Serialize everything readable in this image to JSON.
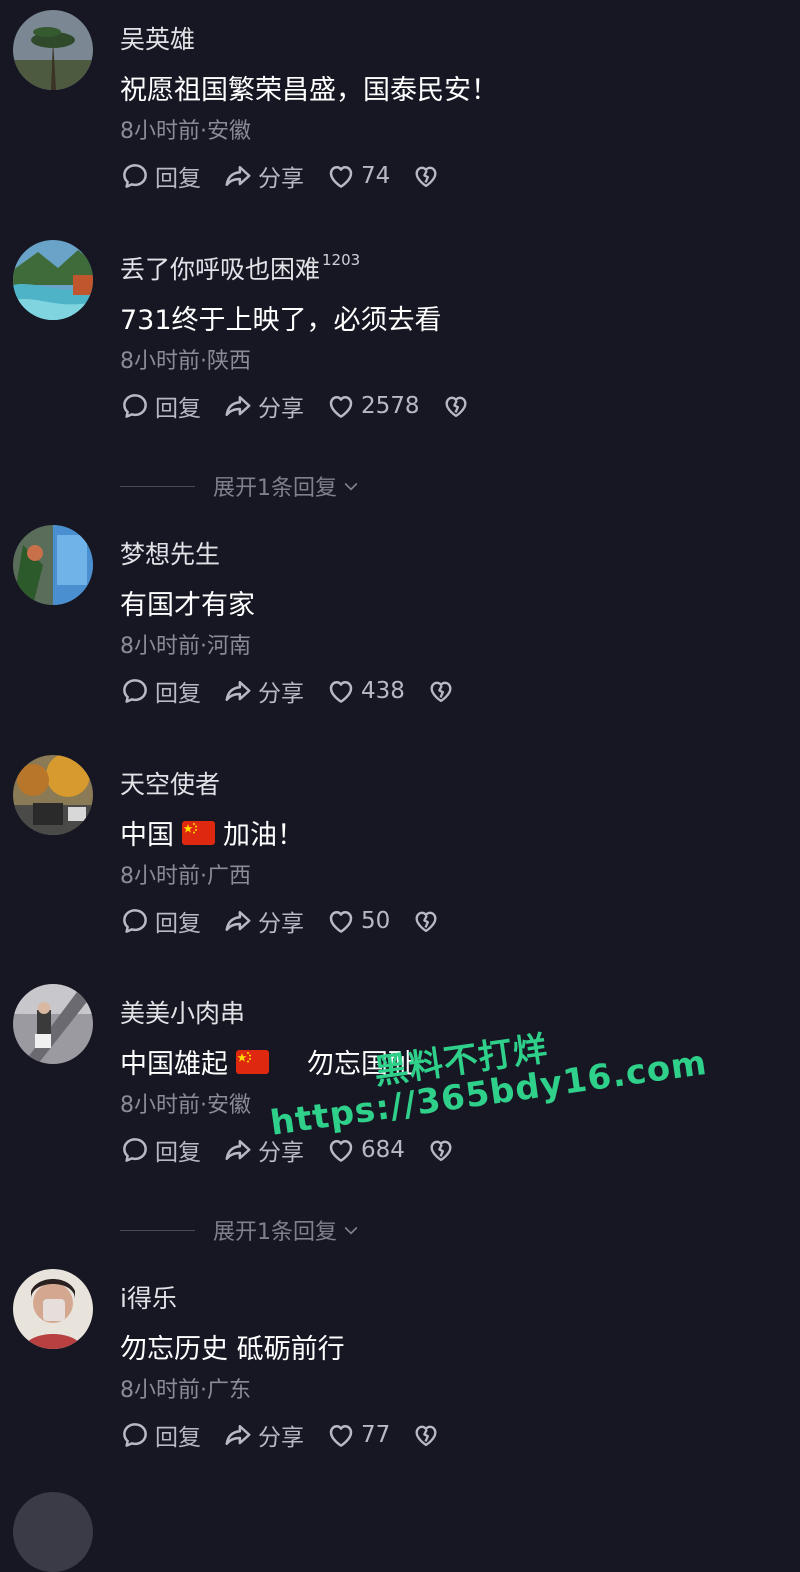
{
  "labels": {
    "reply": "回复",
    "share": "分享"
  },
  "comments": [
    {
      "name": "吴英雄",
      "badge": "",
      "text": "祝愿祖国繁荣昌盛，国泰民安！",
      "meta": "8小时前·安徽",
      "likes": "74",
      "expand": ""
    },
    {
      "name": "丢了你呼吸也困难",
      "badge": "1203",
      "text": "731终于上映了，必须去看",
      "meta": "8小时前·陕西",
      "likes": "2578",
      "expand": "展开1条回复"
    },
    {
      "name": "梦想先生",
      "badge": "",
      "text": "有国才有家",
      "meta": "8小时前·河南",
      "likes": "438",
      "expand": ""
    },
    {
      "name": "天空使者",
      "badge": "",
      "text_a": "中国",
      "text_b": "加油！",
      "meta": "8小时前·广西",
      "likes": "50",
      "expand": ""
    },
    {
      "name": "美美小肉串",
      "badge": "",
      "text_a": "中国雄起",
      "text_b": "勿忘国耻",
      "meta": "8小时前·安徽",
      "likes": "684",
      "expand": "展开1条回复"
    },
    {
      "name": "i得乐",
      "badge": "",
      "text": "勿忘历史 砥砺前行",
      "meta": "8小时前·广东",
      "likes": "77",
      "expand": ""
    }
  ],
  "watermark": {
    "line1": "黑料不打烊",
    "line2": "https://365bdy16.com"
  },
  "colors": {
    "background": "#161723",
    "watermark": "#2fd08a",
    "flag_red": "#de2910",
    "flag_star": "#ffde00"
  }
}
